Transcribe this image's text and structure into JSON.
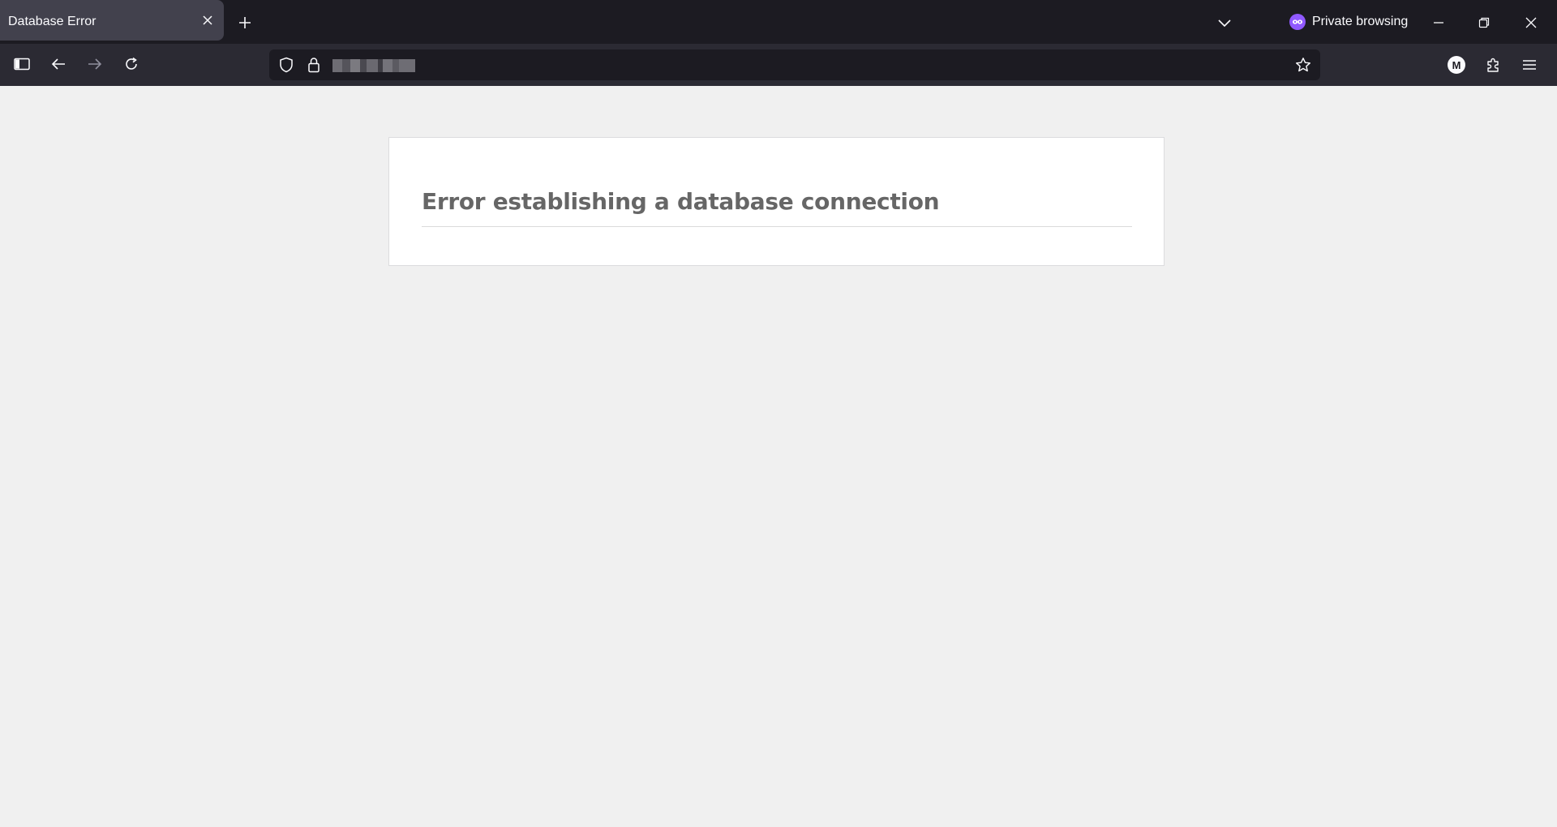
{
  "tab": {
    "title": "Database Error"
  },
  "window": {
    "private_label": "Private browsing"
  },
  "navbar": {
    "account_initial": "M"
  },
  "page": {
    "heading": "Error establishing a database connection"
  },
  "icons": {
    "tab_close": "close-icon",
    "new_tab": "plus-icon",
    "tab_list": "chevron-down-icon",
    "private": "private-mask-icon",
    "minimize": "minimize-icon",
    "restore": "restore-icon",
    "close": "close-icon",
    "sidebar": "sidebar-icon",
    "back": "arrow-left-icon",
    "forward": "arrow-right-icon",
    "reload": "reload-icon",
    "shield": "shield-icon",
    "lock": "lock-icon",
    "bookmark": "star-icon",
    "extensions": "puzzle-icon",
    "menu": "hamburger-icon"
  },
  "colors": {
    "tabstrip_bg": "#1c1b22",
    "active_tab_bg": "#42414d",
    "toolbar_bg": "#2b2a33",
    "urlbar_bg": "#1c1b22",
    "private_accent": "#9059ff",
    "page_bg": "#f0f0f0",
    "heading_color": "#666666"
  }
}
